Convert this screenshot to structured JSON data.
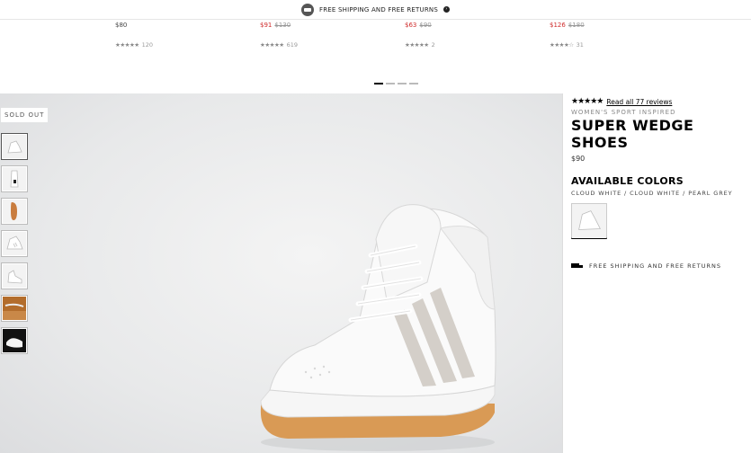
{
  "banner": {
    "text": "FREE SHIPPING AND FREE RETURNS",
    "arrow": "›",
    "icon": "truck-icon"
  },
  "carousel": {
    "items": [
      {
        "price": "$80",
        "old_price": "",
        "sale": false,
        "stars": "★★★★★",
        "reviews": "120"
      },
      {
        "price": "$91",
        "old_price": "$130",
        "sale": true,
        "stars": "★★★★★",
        "reviews": "619"
      },
      {
        "price": "$63",
        "old_price": "$90",
        "sale": true,
        "stars": "★★★★★",
        "reviews": "2"
      },
      {
        "price": "$126",
        "old_price": "$180",
        "sale": true,
        "stars": "★★★★☆",
        "reviews": "31"
      }
    ],
    "page_count": 4,
    "active_page": 1
  },
  "gallery": {
    "sold_out": "SOLD OUT",
    "thumbnail_count": 7
  },
  "product": {
    "stars": "★★★★★",
    "reviews_link": "Read all 77 reviews",
    "category": "WOMEN'S SPORT INSPIRED",
    "title": "SUPER WEDGE SHOES",
    "price": "$90",
    "colors_heading": "AVAILABLE COLORS",
    "color_name": "CLOUD WHITE / CLOUD WHITE / PEARL GREY",
    "shipping": "FREE SHIPPING AND FREE RETURNS"
  },
  "colors": {
    "accent": "#000000",
    "sale": "#d02d2d",
    "gallery_bg": "#e9eaeb"
  }
}
